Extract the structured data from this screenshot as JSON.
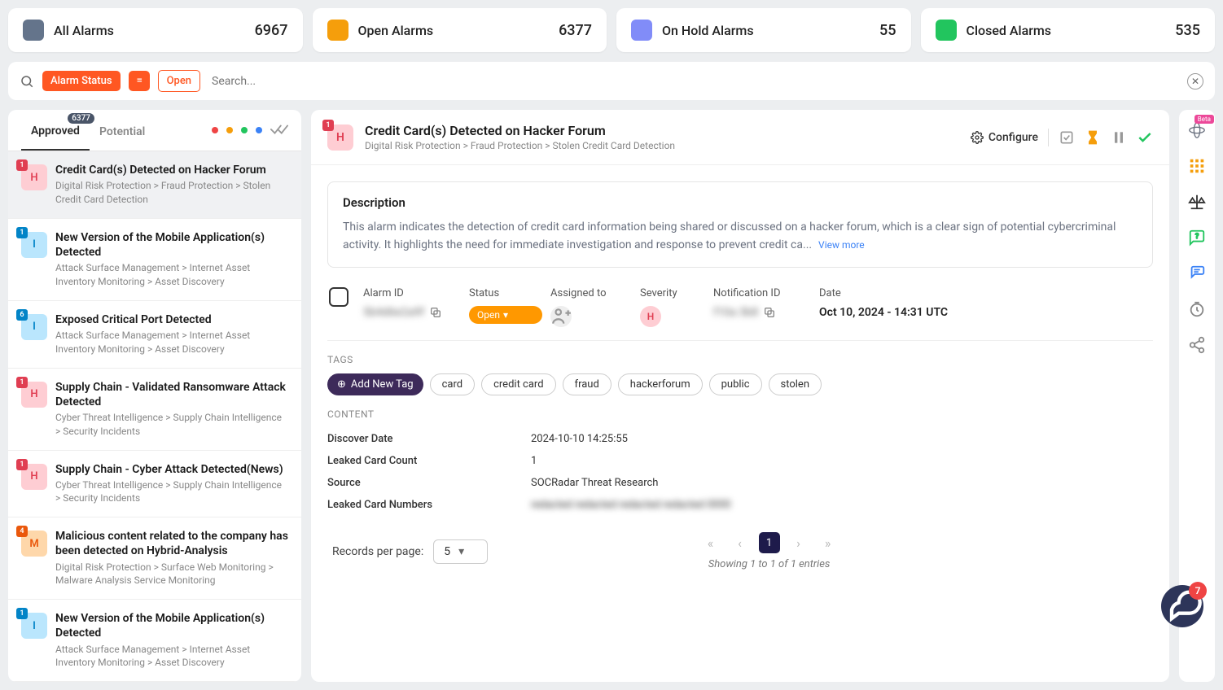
{
  "stats": [
    {
      "label": "All Alarms",
      "value": "6967",
      "color": "#64748b"
    },
    {
      "label": "Open Alarms",
      "value": "6377",
      "color": "#f59e0b"
    },
    {
      "label": "On Hold Alarms",
      "value": "55",
      "color": "#818cf8"
    },
    {
      "label": "Closed Alarms",
      "value": "535",
      "color": "#22c55e"
    }
  ],
  "search": {
    "status_chip": "Alarm Status",
    "eq_chip": "=",
    "open_chip": "Open",
    "placeholder": "Search..."
  },
  "tabs": {
    "approved": "Approved",
    "approved_badge": "6377",
    "potential": "Potential",
    "dots": [
      "#ef4444",
      "#f59e0b",
      "#22c55e",
      "#3b82f6"
    ]
  },
  "alarms": [
    {
      "sev": "H",
      "count": "1",
      "title": "Credit Card(s) Detected on Hacker Forum",
      "path": "Digital Risk Protection > Fraud Protection > Stolen Credit Card Detection",
      "selected": true
    },
    {
      "sev": "I",
      "count": "1",
      "title": "New Version of the Mobile Application(s) Detected",
      "path": "Attack Surface Management > Internet Asset Inventory Monitoring > Asset Discovery",
      "selected": false
    },
    {
      "sev": "I",
      "count": "6",
      "title": "Exposed Critical Port Detected",
      "path": "Attack Surface Management > Internet Asset Inventory Monitoring > Asset Discovery",
      "selected": false
    },
    {
      "sev": "H",
      "count": "1",
      "title": "Supply Chain - Validated Ransomware Attack Detected",
      "path": "Cyber Threat Intelligence > Supply Chain Intelligence > Security Incidents",
      "selected": false
    },
    {
      "sev": "H",
      "count": "1",
      "title": "Supply Chain - Cyber Attack Detected(News)",
      "path": "Cyber Threat Intelligence > Supply Chain Intelligence > Security Incidents",
      "selected": false
    },
    {
      "sev": "M",
      "count": "4",
      "title": "Malicious content related to the company has been detected on Hybrid-Analysis",
      "path": "Digital Risk Protection > Surface Web Monitoring > Malware Analysis Service Monitoring",
      "selected": false
    },
    {
      "sev": "I",
      "count": "1",
      "title": "New Version of the Mobile Application(s) Detected",
      "path": "Attack Surface Management > Internet Asset Inventory Monitoring > Asset Discovery",
      "selected": false
    }
  ],
  "detail": {
    "sev": "H",
    "sev_count": "1",
    "title": "Credit Card(s) Detected on Hacker Forum",
    "path": "Digital Risk Protection > Fraud Protection > Stolen Credit Card Detection",
    "configure": "Configure",
    "description_label": "Description",
    "description": "This alarm indicates the detection of credit card information being shared or discussed on a hacker forum, which is a clear sign of potential cybercriminal activity. It highlights the need for immediate investigation and response to prevent credit ca...",
    "view_more": "View more",
    "meta": {
      "alarm_id_label": "Alarm ID",
      "alarm_id": "5b4d6e2a9f",
      "status_label": "Status",
      "status": "Open",
      "assigned_label": "Assigned to",
      "severity_label": "Severity",
      "severity": "H",
      "notification_label": "Notification ID",
      "notification_id": "f10a 3b8",
      "date_label": "Date",
      "date": "Oct 10, 2024 - 14:31 UTC"
    },
    "tags_label": "TAGS",
    "add_tag": "Add New Tag",
    "tags": [
      "card",
      "credit card",
      "fraud",
      "hackerforum",
      "public",
      "stolen"
    ],
    "content_label": "CONTENT",
    "content": [
      {
        "key": "Discover Date",
        "val": "2024-10-10 14:25:55",
        "blur": false
      },
      {
        "key": "Leaked Card Count",
        "val": "1",
        "blur": false
      },
      {
        "key": "Source",
        "val": "SOCRadar Threat Research",
        "blur": false
      },
      {
        "key": "Leaked Card Numbers",
        "val": "redacted redacted redacted redacted 0000",
        "blur": true
      }
    ]
  },
  "pagination": {
    "rpp_label": "Records per page:",
    "rpp_value": "5",
    "current": "1",
    "info": "Showing 1 to 1 of 1 entries"
  },
  "rail": {
    "beta": "Beta"
  },
  "fab_count": "7"
}
